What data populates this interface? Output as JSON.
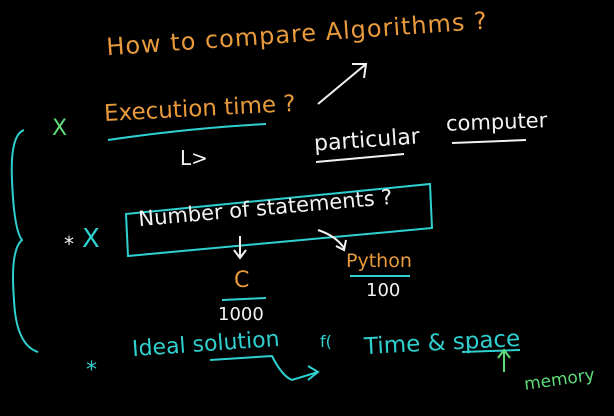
{
  "title": "How to compare Algorithms ?",
  "execution_time": "Execution time ?",
  "particular": "particular",
  "computer": "computer",
  "number_of_statements": "Number of statements ?",
  "c_label": "C",
  "c_value": "1000",
  "python_label": "Python",
  "python_value": "100",
  "ideal_solution": "Ideal solution",
  "f_symbol": "f(",
  "time_space": "Time & space",
  "memory": "memory",
  "bullet_star": "*",
  "bullet_x": "X",
  "arrow_glyph": "L>",
  "colors": {
    "orange": "#e89a3c",
    "cyan": "#2fd0cf",
    "white": "#f2f2f2",
    "green": "#5fdc7a",
    "background": "#000000"
  }
}
